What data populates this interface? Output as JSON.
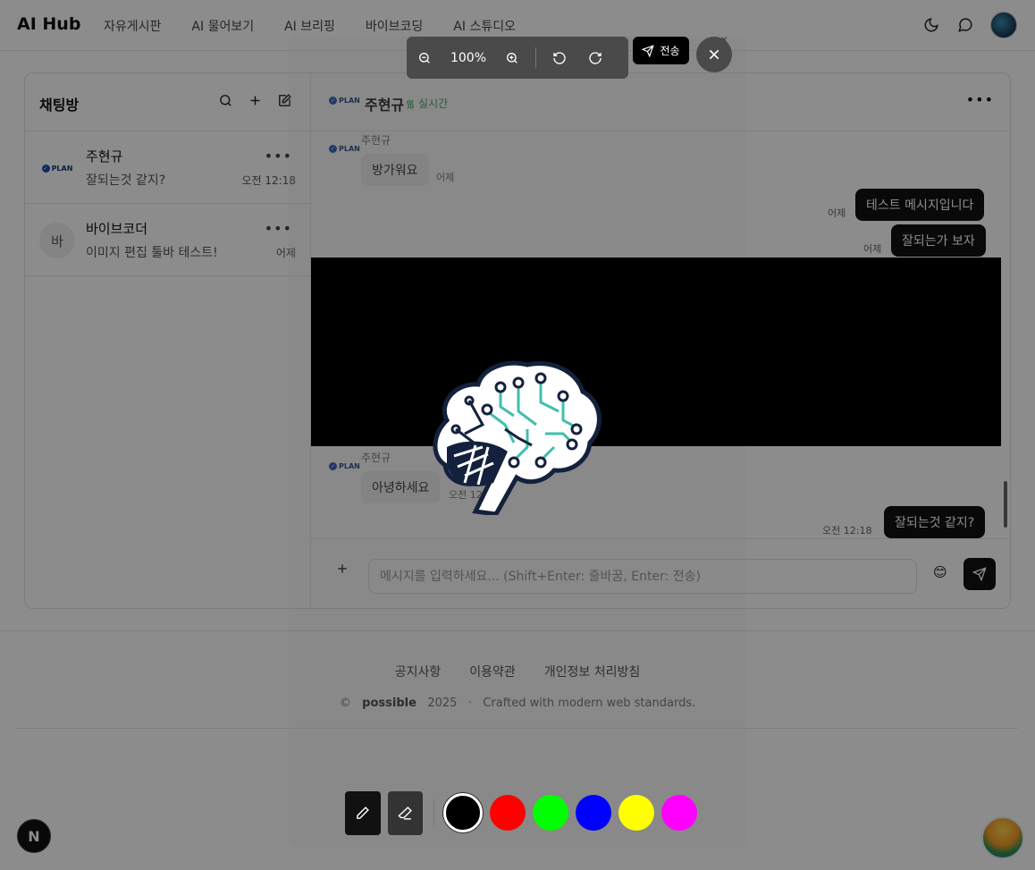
{
  "brand": "AI Hub",
  "nav": [
    "자유게시판",
    "AI 물어보기",
    "AI 브리핑",
    "바이브코딩",
    "AI 스튜디오"
  ],
  "sidebar": {
    "title": "채팅방",
    "rooms": [
      {
        "name": "주현규",
        "last": "잘되는것 같지?",
        "time": "오전 12:18",
        "avatar": "PLAN"
      },
      {
        "name": "바이브코더",
        "last": "이미지 편집 툴바 테스트!",
        "time": "어제",
        "avatar": "바"
      }
    ]
  },
  "chat": {
    "name": "주현규",
    "status": "실시간",
    "logo": "PLAN",
    "messages": [
      {
        "from": "주현규",
        "text": "방가워요",
        "time": "어제",
        "dir": "in"
      },
      {
        "text": "테스트 메시지입니다",
        "time": "어제",
        "dir": "out"
      },
      {
        "text": "잘되는가 보자",
        "time": "어제",
        "dir": "out"
      },
      {
        "from": "주현규",
        "text": "아녕하세요",
        "time": "오전 12",
        "dir": "in"
      },
      {
        "text": "잘되는것 같지?",
        "time": "오전 12:18",
        "dir": "out"
      }
    ],
    "input_placeholder": "메시지를 입력하세요... (Shift+Enter: 줄바꿈, Enter: 전송)"
  },
  "footer": {
    "links": [
      "공지사항",
      "이용약관",
      "개인정보 처리방침"
    ],
    "copy_symbol": "©",
    "copy_brand": "possible",
    "copy_year": "2025",
    "copy_dot": "·",
    "copy_tagline": "Crafted with modern web standards."
  },
  "editor": {
    "zoom": "100%",
    "send_label": "전송",
    "colors": [
      "#000000",
      "#ff0000",
      "#00ff00",
      "#0000ff",
      "#ffff00",
      "#ff00ff"
    ],
    "selected_color": "#000000"
  },
  "next_badge": "N"
}
